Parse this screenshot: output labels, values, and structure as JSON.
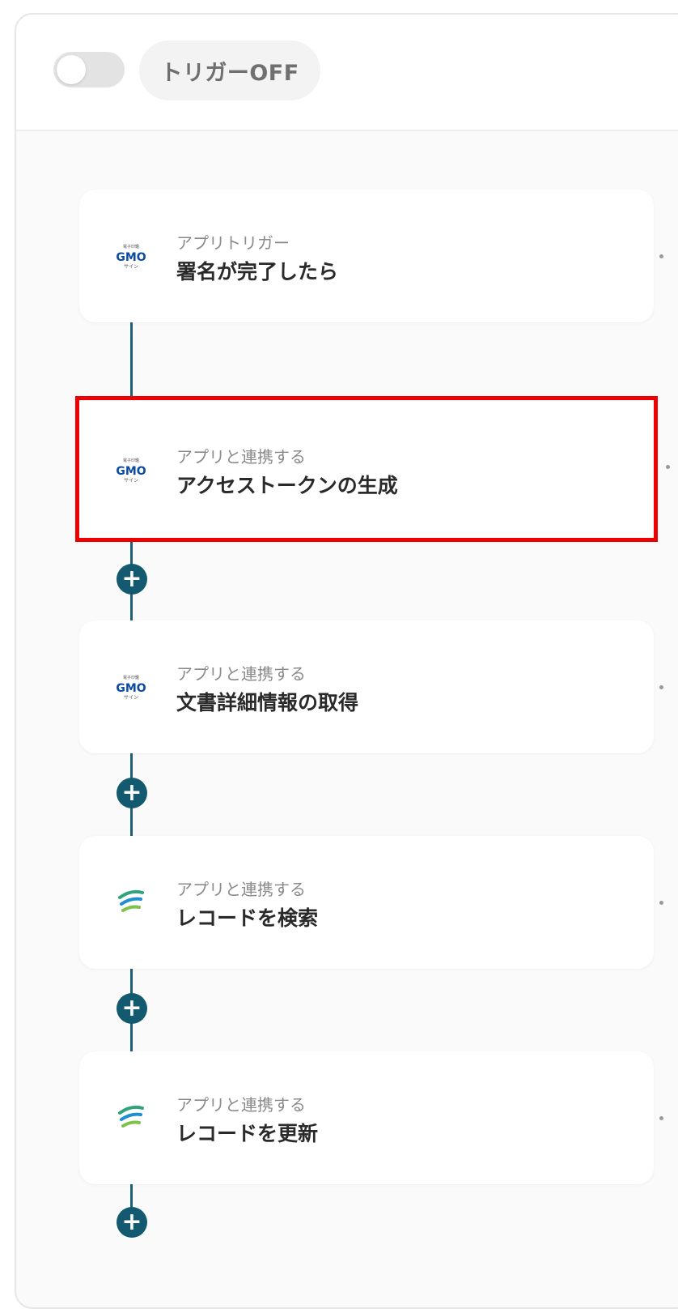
{
  "header": {
    "trigger_label": "トリガーOFF",
    "trigger_enabled": false
  },
  "steps": [
    {
      "subtitle": "アプリトリガー",
      "title": "署名が完了したら",
      "icon": "gmo-sign-icon",
      "highlighted": false
    },
    {
      "subtitle": "アプリと連携する",
      "title": "アクセストークンの生成",
      "icon": "gmo-sign-icon",
      "highlighted": true
    },
    {
      "subtitle": "アプリと連携する",
      "title": "文書詳細情報の取得",
      "icon": "gmo-sign-icon",
      "highlighted": false
    },
    {
      "subtitle": "アプリと連携する",
      "title": "レコードを検索",
      "icon": "kintone-wave-icon",
      "highlighted": false
    },
    {
      "subtitle": "アプリと連携する",
      "title": "レコードを更新",
      "icon": "kintone-wave-icon",
      "highlighted": false
    }
  ],
  "add_button_label": "+",
  "colors": {
    "connector": "#1f5f72",
    "add_button": "#135a70",
    "highlight_border": "#ee0000",
    "toggle_off": "#e3e3e3"
  }
}
